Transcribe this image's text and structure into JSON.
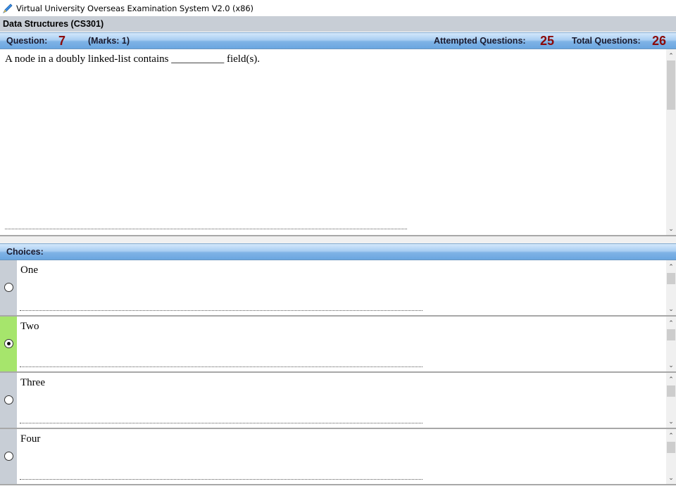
{
  "window": {
    "title": "Virtual University Overseas Examination System  V2.0 (x86)",
    "icon": "pen-icon"
  },
  "subject": {
    "label": "Data Structures  (CS301)"
  },
  "question_bar": {
    "question_label": "Question:",
    "question_number": "7",
    "marks": "(Marks: 1)",
    "attempted_label": "Attempted Questions:",
    "attempted_value": "25",
    "total_label": "Total Questions:",
    "total_value": "26",
    "number_color": "#8b0a0a"
  },
  "question": {
    "text": "A node in a doubly linked-list contains __________ field(s)."
  },
  "choices_header": {
    "label": "Choices:"
  },
  "choices": [
    {
      "text": "One",
      "selected": false
    },
    {
      "text": "Two",
      "selected": true
    },
    {
      "text": "Three",
      "selected": false
    },
    {
      "text": "Four",
      "selected": false
    }
  ],
  "colors": {
    "selected_choice": "#a6e56c",
    "unselected_choice": "#c8ced6",
    "header_blue": "#7fb3e6"
  }
}
